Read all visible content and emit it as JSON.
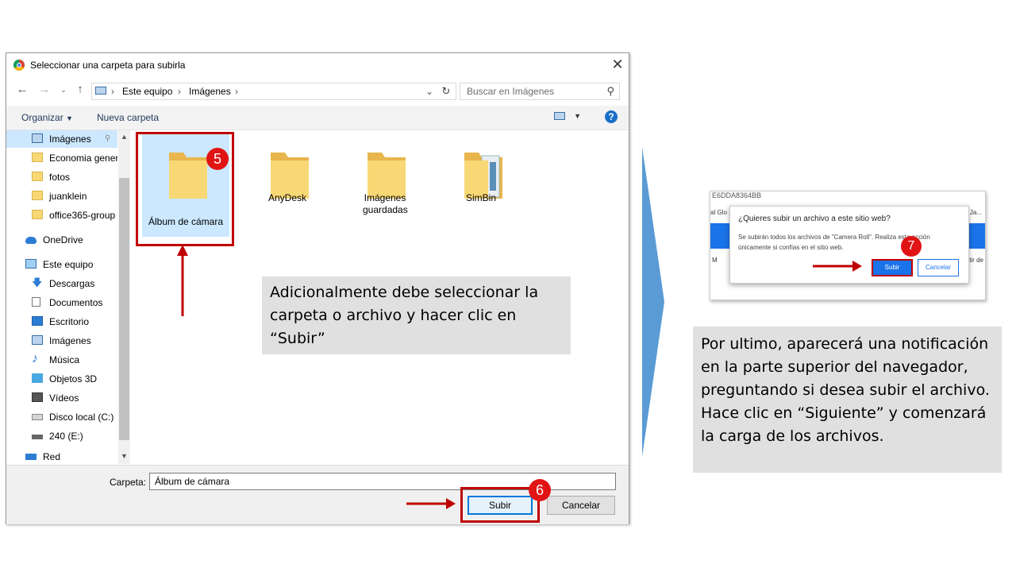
{
  "dialog": {
    "title": "Seleccionar una carpeta para subirla",
    "address": {
      "segments": [
        "Este equipo",
        "Imágenes"
      ]
    },
    "search_placeholder": "Buscar en Imágenes",
    "toolbar": {
      "organize": "Organizar",
      "new_folder": "Nueva carpeta"
    },
    "nav_items": [
      {
        "label": "Imágenes",
        "icon": "pictures-icon",
        "selected": true
      },
      {
        "label": "Economia gener",
        "icon": "folder-icon"
      },
      {
        "label": "fotos",
        "icon": "folder-icon"
      },
      {
        "label": "juanklein",
        "icon": "folder-icon"
      },
      {
        "label": "office365-group",
        "icon": "folder-icon"
      },
      {
        "label": "OneDrive",
        "icon": "cloud-icon"
      },
      {
        "label": "Este equipo",
        "icon": "computer-icon"
      },
      {
        "label": "Descargas",
        "icon": "download-icon"
      },
      {
        "label": "Documentos",
        "icon": "documents-icon"
      },
      {
        "label": "Escritorio",
        "icon": "desktop-icon"
      },
      {
        "label": "Imágenes",
        "icon": "pictures-icon"
      },
      {
        "label": "Música",
        "icon": "music-icon"
      },
      {
        "label": "Objetos 3D",
        "icon": "cube-icon"
      },
      {
        "label": "Vídeos",
        "icon": "video-icon"
      },
      {
        "label": "Disco local (C:)",
        "icon": "disk-icon"
      },
      {
        "label": "240 (E:)",
        "icon": "drive-icon"
      },
      {
        "label": "Red",
        "icon": "network-icon"
      }
    ],
    "folders": [
      {
        "label": "Álbum de cámara",
        "selected": true
      },
      {
        "label": "AnyDesk"
      },
      {
        "label": "Imágenes guardadas"
      },
      {
        "label": "SimBin"
      }
    ],
    "folder_field_label": "Carpeta:",
    "folder_field_value": "Álbum de cámara",
    "upload_button": "Subir",
    "cancel_button": "Cancelar"
  },
  "badges": {
    "b5": "5",
    "b6": "6",
    "b7": "7"
  },
  "callout1": "Adicionalmente debe seleccionar la carpeta o archivo y hacer clic en “Subir”",
  "callout2": "Por ultimo, aparecerá una notificación en la parte superior del navegador, preguntando si desea subir el archivo. Hace clic en “Siguiente” y comenzará la carga de los archivos.",
  "notification": {
    "id_text": "E6DDA8364BB",
    "side_left": "al Glo",
    "side_right": "Ja...",
    "side_left2": "M",
    "side_right2": "tir de",
    "question": "¿Quieres subir un archivo a este sitio web?",
    "description": "Se subirán todos los archivos de \"Camera Roll\". Realiza esta acción únicamente si confías en el sitio web.",
    "upload_button": "Subir",
    "cancel_button": "Cancelar"
  },
  "colors": {
    "annotation_red": "#c00000",
    "badge_red": "#e11414",
    "selection_blue": "#cce8ff",
    "arrow_blue": "#5b9bd5"
  }
}
